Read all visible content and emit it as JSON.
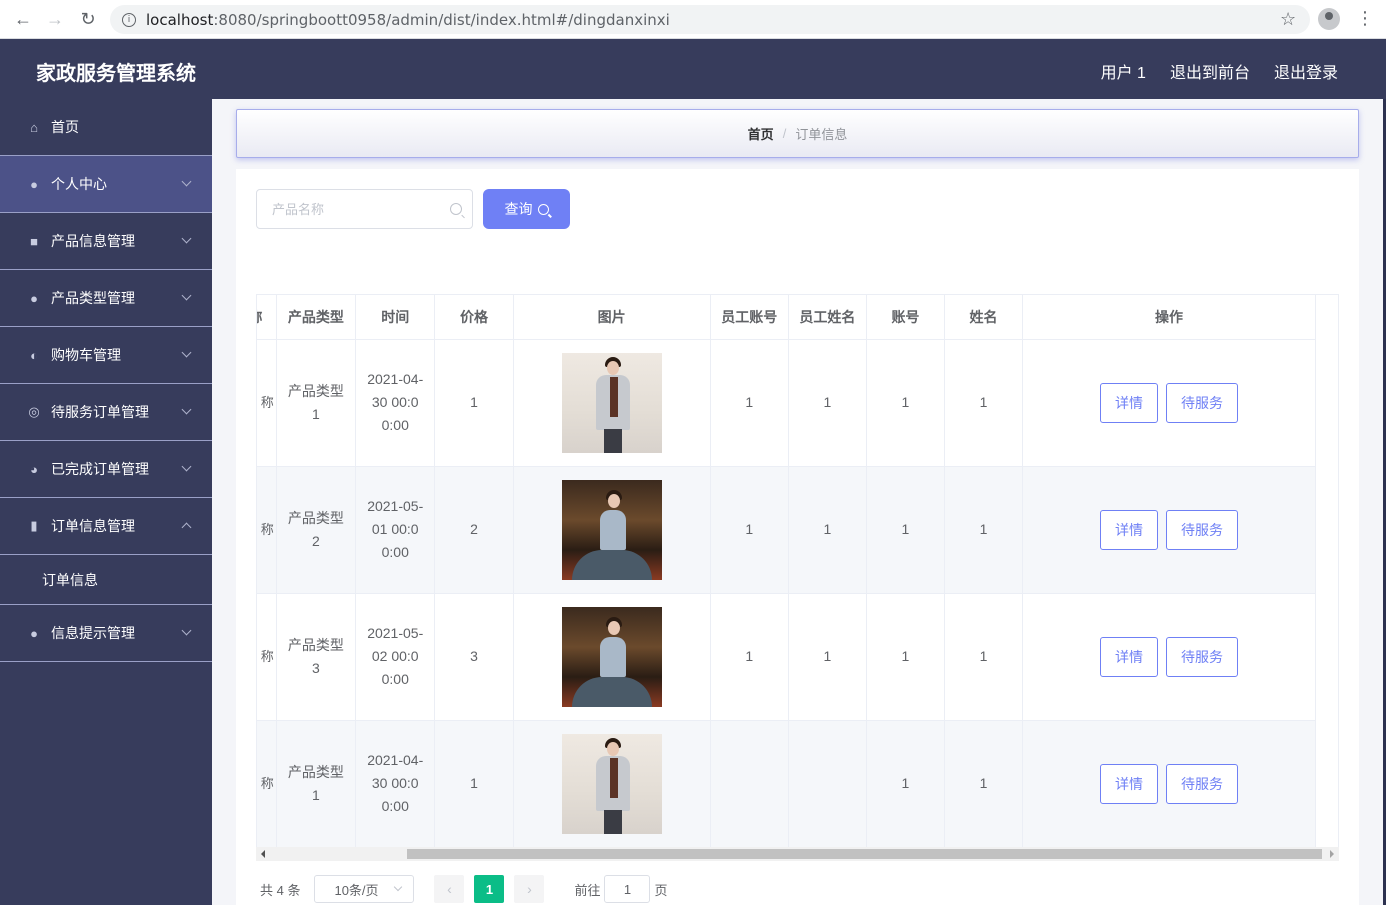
{
  "browser": {
    "url_host": "localhost",
    "url_rest": ":8080/springboott0958/admin/dist/index.html#/dingdanxinxi"
  },
  "header": {
    "title": "家政服务管理系统",
    "links": [
      "用户 1",
      "退出到前台",
      "退出登录"
    ]
  },
  "sidebar": {
    "items": [
      {
        "label": "首页",
        "icon": "home-icon"
      },
      {
        "label": "个人中心",
        "icon": "user-icon"
      },
      {
        "label": "产品信息管理",
        "icon": "monitor-icon"
      },
      {
        "label": "产品类型管理",
        "icon": "user-icon"
      },
      {
        "label": "购物车管理",
        "icon": "dashboard-icon"
      },
      {
        "label": "待服务订单管理",
        "icon": "lifebuoy-icon"
      },
      {
        "label": "已完成订单管理",
        "icon": "compass-icon"
      },
      {
        "label": "订单信息管理",
        "icon": "bar-chart-icon"
      },
      {
        "label": "信息提示管理",
        "icon": "user-icon"
      }
    ],
    "sub_item": "订单信息"
  },
  "breadcrumb": {
    "home": "首页",
    "separator": "/",
    "current": "订单信息"
  },
  "search": {
    "placeholder": "产品名称",
    "button": "查询"
  },
  "table": {
    "columns": [
      "称",
      "产品类型",
      "时间",
      "价格",
      "图片",
      "员工账号",
      "员工姓名",
      "账号",
      "姓名",
      "操作"
    ],
    "rows": [
      {
        "name": "称",
        "type": "产品类型1",
        "time": "2021-04-30 00:00:00",
        "price": "1",
        "img": "light",
        "emp_account": "1",
        "emp_name": "1",
        "account": "1",
        "username": "1"
      },
      {
        "name": "称",
        "type": "产品类型2",
        "time": "2021-05-01 00:00:00",
        "price": "2",
        "img": "dark",
        "emp_account": "1",
        "emp_name": "1",
        "account": "1",
        "username": "1"
      },
      {
        "name": "称",
        "type": "产品类型3",
        "time": "2021-05-02 00:00:00",
        "price": "3",
        "img": "dark",
        "emp_account": "1",
        "emp_name": "1",
        "account": "1",
        "username": "1"
      },
      {
        "name": "称",
        "type": "产品类型1",
        "time": "2021-04-30 00:00:00",
        "price": "1",
        "img": "light",
        "emp_account": "",
        "emp_name": "",
        "account": "1",
        "username": "1"
      }
    ],
    "actions": {
      "detail": "详情",
      "service": "待服务"
    }
  },
  "pagination": {
    "total": "共 4 条",
    "page_size": "10条/页",
    "current_page": "1",
    "goto_prefix": "前往",
    "goto_value": "1",
    "goto_suffix": "页"
  },
  "colors": {
    "header_bg": "#373c5c",
    "accent": "#6f80f5",
    "page_active": "#0bbd87"
  }
}
